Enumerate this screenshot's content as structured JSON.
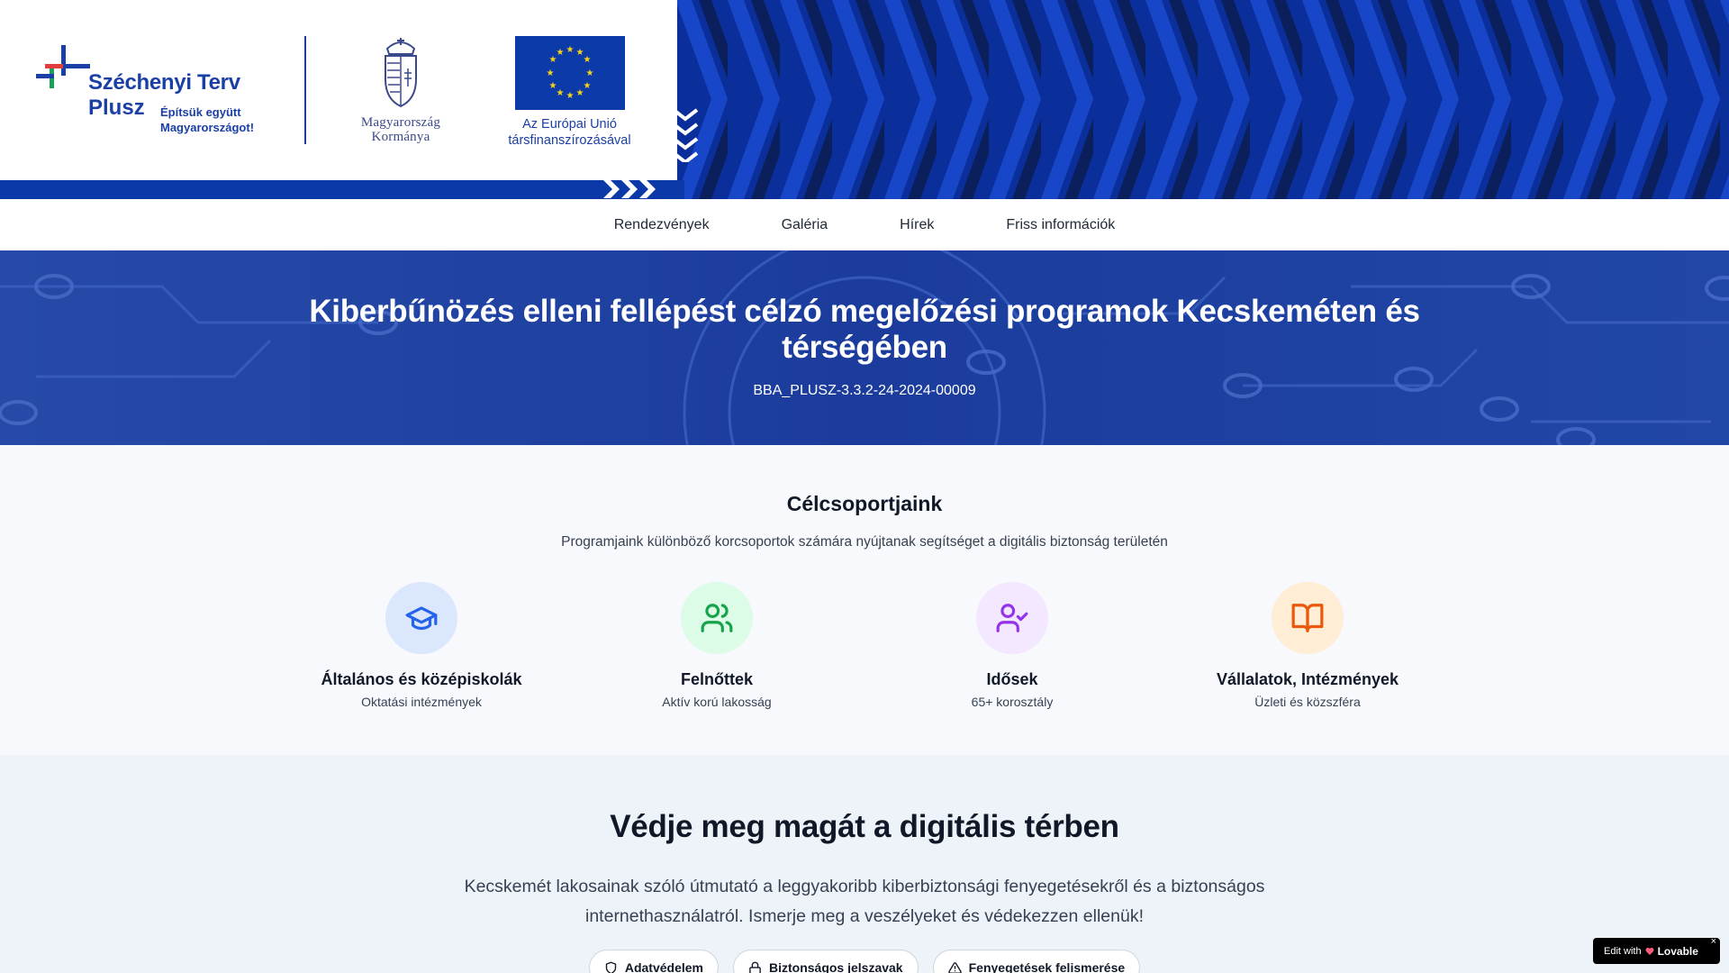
{
  "banner": {
    "szechenyi_title": "Széchenyi Terv",
    "szechenyi_plus": "Plusz",
    "szechenyi_slogan": "Építsük együtt Magyarországot!",
    "kormany_line1": "Magyarország",
    "kormany_line2": "Kormánya",
    "eu_line1": "Az Európai Unió",
    "eu_line2": "társfinanszírozásával"
  },
  "nav": {
    "items": [
      "Rendezvények",
      "Galéria",
      "Hírek",
      "Friss információk"
    ]
  },
  "hero": {
    "title": "Kiberbűnözés elleni fellépést célzó megelőzési programok Kecskeméten és térségében",
    "code": "BBA_PLUSZ-3.3.2-24-2024-00009"
  },
  "groups": {
    "title": "Célcsoportjaink",
    "subtitle": "Programjaink különböző korcsoportok számára nyújtanak segítséget a digitális biztonság területén",
    "items": [
      {
        "name": "Általános és középiskolák",
        "desc": "Oktatási intézmények",
        "icon": "graduation-cap-icon",
        "color": "#2563eb",
        "bg": "#dbe7fd"
      },
      {
        "name": "Felnőttek",
        "desc": "Aktív korú lakosság",
        "icon": "users-icon",
        "color": "#16a34a",
        "bg": "#dcfce7"
      },
      {
        "name": "Idősek",
        "desc": "65+ korosztály",
        "icon": "user-check-icon",
        "color": "#9333ea",
        "bg": "#f3e8ff"
      },
      {
        "name": "Vállalatok, Intézmények",
        "desc": "Üzleti és közszféra",
        "icon": "book-open-icon",
        "color": "#ea580c",
        "bg": "#ffedd5"
      }
    ]
  },
  "protect": {
    "title": "Védje meg magát a digitális térben",
    "text": "Kecskemét lakosainak szóló útmutató a leggyakoribb kiberbiztonsági fenyegetésekről és a biztonságos internethasználatról. Ismerje meg a veszélyeket és védekezzen ellenük!",
    "chips": [
      {
        "label": "Adatvédelem",
        "icon": "shield-icon"
      },
      {
        "label": "Biztonságos jelszavak",
        "icon": "lock-icon"
      },
      {
        "label": "Fenyegetések felismerése",
        "icon": "alert-triangle-icon"
      }
    ]
  },
  "lovable": {
    "edit": "Edit with",
    "brand": "Lovable",
    "close": "×"
  },
  "colors": {
    "banner_blue": "#0a2a8a",
    "hero_blue": "#1d3f9f",
    "brand_blue": "#1a3fa6"
  }
}
